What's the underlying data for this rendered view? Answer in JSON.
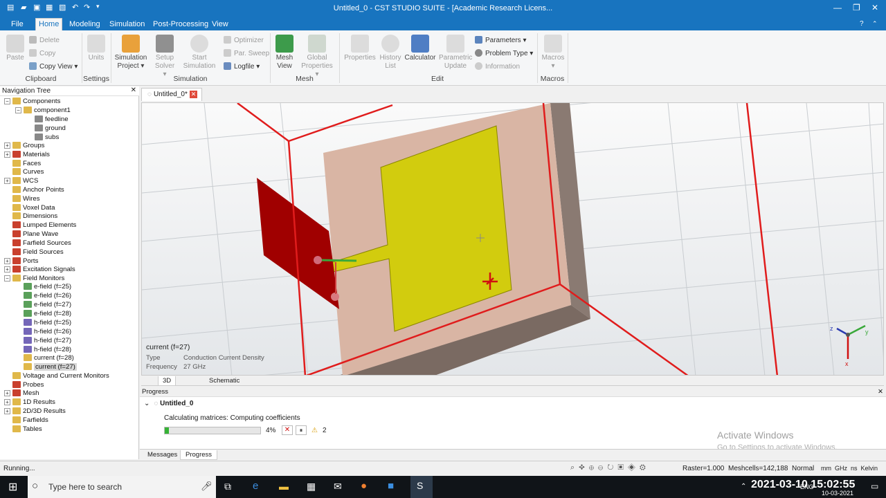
{
  "window": {
    "title": "Untitled_0 - CST STUDIO SUITE - [Academic Research Licens...",
    "controls": {
      "minimize": "—",
      "restore": "❐",
      "close": "✕"
    }
  },
  "ribbon": {
    "tabs": [
      "File",
      "Home",
      "Modeling",
      "Simulation",
      "Post-Processing",
      "View"
    ],
    "active_tab": "Home",
    "clipboard": {
      "paste": "Paste",
      "delete": "Delete",
      "copy": "Copy",
      "copy_view": "Copy View",
      "group": "Clipboard"
    },
    "settings": {
      "units": "Units",
      "group": "Settings"
    },
    "simulation": {
      "simulation_project_1": "Simulation",
      "simulation_project_2": "Project",
      "setup_solver_1": "Setup",
      "setup_solver_2": "Solver",
      "start_sim_1": "Start",
      "start_sim_2": "Simulation",
      "optimizer": "Optimizer",
      "par_sweep": "Par. Sweep",
      "logfile": "Logfile",
      "group": "Simulation"
    },
    "mesh": {
      "mesh_view_1": "Mesh",
      "mesh_view_2": "View",
      "global_props_1": "Global",
      "global_props_2": "Properties",
      "group": "Mesh"
    },
    "edit": {
      "properties": "Properties",
      "history_1": "History",
      "history_2": "List",
      "calculator": "Calculator",
      "param_update_1": "Parametric",
      "param_update_2": "Update",
      "parameters": "Parameters",
      "problem_type": "Problem Type",
      "information": "Information",
      "group": "Edit"
    },
    "macros": {
      "macros_btn": "Macros",
      "group": "Macros"
    }
  },
  "nav": {
    "title": "Navigation Tree",
    "items": [
      {
        "label": "Components",
        "level": 0,
        "exp": "−"
      },
      {
        "label": "component1",
        "level": 1,
        "exp": "−"
      },
      {
        "label": "feedline",
        "level": 2,
        "exp": ""
      },
      {
        "label": "ground",
        "level": 2,
        "exp": ""
      },
      {
        "label": "subs",
        "level": 2,
        "exp": ""
      },
      {
        "label": "Groups",
        "level": 0,
        "exp": "+"
      },
      {
        "label": "Materials",
        "level": 0,
        "exp": "+"
      },
      {
        "label": "Faces",
        "level": 0,
        "exp": ""
      },
      {
        "label": "Curves",
        "level": 0,
        "exp": ""
      },
      {
        "label": "WCS",
        "level": 0,
        "exp": "+"
      },
      {
        "label": "Anchor Points",
        "level": 0,
        "exp": ""
      },
      {
        "label": "Wires",
        "level": 0,
        "exp": ""
      },
      {
        "label": "Voxel Data",
        "level": 0,
        "exp": ""
      },
      {
        "label": "Dimensions",
        "level": 0,
        "exp": ""
      },
      {
        "label": "Lumped Elements",
        "level": 0,
        "exp": ""
      },
      {
        "label": "Plane Wave",
        "level": 0,
        "exp": ""
      },
      {
        "label": "Farfield Sources",
        "level": 0,
        "exp": ""
      },
      {
        "label": "Field Sources",
        "level": 0,
        "exp": ""
      },
      {
        "label": "Ports",
        "level": 0,
        "exp": "+"
      },
      {
        "label": "Excitation Signals",
        "level": 0,
        "exp": "+"
      },
      {
        "label": "Field Monitors",
        "level": 0,
        "exp": "−"
      },
      {
        "label": "e-field (f=25)",
        "level": 1,
        "exp": ""
      },
      {
        "label": "e-field (f=26)",
        "level": 1,
        "exp": ""
      },
      {
        "label": "e-field (f=27)",
        "level": 1,
        "exp": ""
      },
      {
        "label": "e-field (f=28)",
        "level": 1,
        "exp": ""
      },
      {
        "label": "h-field (f=25)",
        "level": 1,
        "exp": ""
      },
      {
        "label": "h-field (f=26)",
        "level": 1,
        "exp": ""
      },
      {
        "label": "h-field (f=27)",
        "level": 1,
        "exp": ""
      },
      {
        "label": "h-field (f=28)",
        "level": 1,
        "exp": ""
      },
      {
        "label": "current (f=28)",
        "level": 1,
        "exp": ""
      },
      {
        "label": "current (f=27)",
        "level": 1,
        "exp": ""
      },
      {
        "label": "Voltage and Current Monitors",
        "level": 0,
        "exp": ""
      },
      {
        "label": "Probes",
        "level": 0,
        "exp": ""
      },
      {
        "label": "Mesh",
        "level": 0,
        "exp": "+"
      },
      {
        "label": "1D Results",
        "level": 0,
        "exp": "+"
      },
      {
        "label": "2D/3D Results",
        "level": 0,
        "exp": "+"
      },
      {
        "label": "Farfields",
        "level": 0,
        "exp": ""
      },
      {
        "label": "Tables",
        "level": 0,
        "exp": ""
      }
    ]
  },
  "document": {
    "tab_label": "Untitled_0*"
  },
  "viewport": {
    "info_title": "current (f=27)",
    "type_label": "Type",
    "type_value": "Conduction Current Density",
    "freq_label": "Frequency",
    "freq_value": "27 GHz",
    "tabs": [
      "3D",
      "Schematic"
    ],
    "axis": {
      "x": "x",
      "y": "y",
      "z": "z"
    }
  },
  "progress": {
    "panel_title": "Progress",
    "project": "Untitled_0",
    "message": "Calculating matrices: Computing coefficients",
    "percent_text": "4%",
    "fraction": 0.04,
    "warnings": "2"
  },
  "bottom_tabs": [
    "Messages",
    "Progress"
  ],
  "status": {
    "left": "Running...",
    "raster": "Raster=1.000",
    "meshcells": "Meshcells=142,188",
    "mode": "Normal",
    "units": "mm  GHz  ns  Kelvin"
  },
  "watermark": {
    "line1": "Activate Windows",
    "line2": "Go to Settings to activate Windows."
  },
  "overlay_datetime": "2021-03-10  15:02:55",
  "taskbar": {
    "search_placeholder": "Type here to search",
    "lang": "ENG",
    "date": "10-03-2021"
  }
}
